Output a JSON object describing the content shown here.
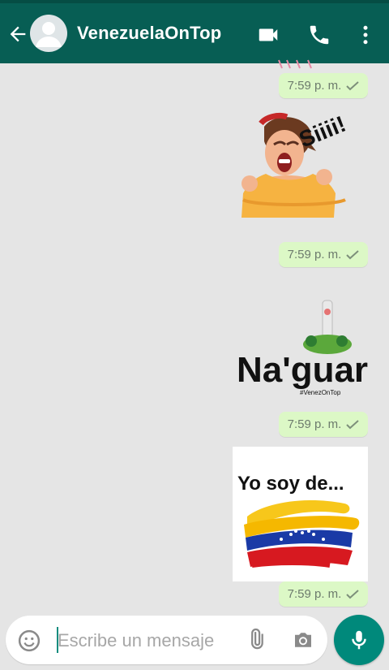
{
  "header": {
    "title": "VenezuelaOnTop",
    "icons": [
      "back-arrow-icon",
      "video-call-icon",
      "phone-icon",
      "more-vert-icon"
    ]
  },
  "messages": [
    {
      "time": "7:59 p. m."
    },
    {
      "time": "7:59 p. m.",
      "sticker_text": "Siiii!"
    },
    {
      "time": "7:59 p. m.",
      "sticker_text": "Na'guará"
    },
    {
      "time": "7:59 p. m.",
      "sticker_text": "Yo soy de..."
    }
  ],
  "composer": {
    "placeholder": "Escribe un mensaje"
  },
  "colors": {
    "header": "#075e54",
    "bubble": "#dcf8c6",
    "fab": "#00897b"
  }
}
